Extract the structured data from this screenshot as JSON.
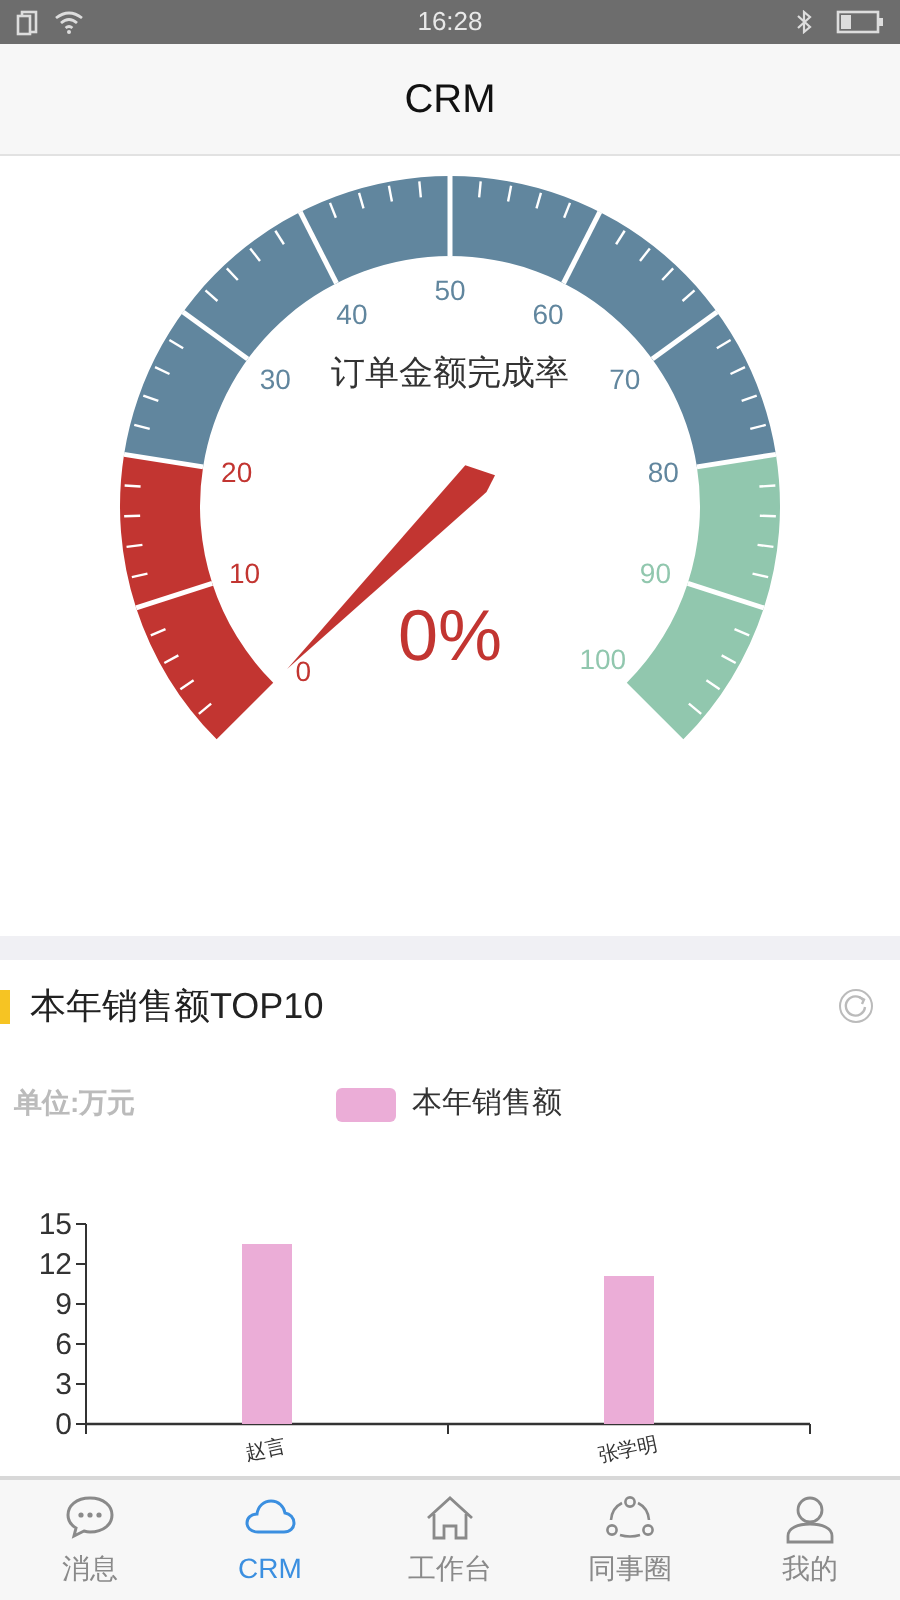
{
  "status_bar": {
    "time": "16:28"
  },
  "header": {
    "title": "CRM"
  },
  "gauge": {
    "title": "订单金额完成率",
    "value_text": "0%",
    "tick_labels": [
      "0",
      "10",
      "20",
      "30",
      "40",
      "50",
      "60",
      "70",
      "80",
      "90",
      "100"
    ],
    "bands": [
      {
        "color": "#c23531"
      },
      {
        "color": "#61869e"
      },
      {
        "color": "#91c7ae"
      }
    ]
  },
  "sales_section": {
    "title": "本年销售额TOP10",
    "chart_data": {
      "type": "bar",
      "ylabel": "单位:万元",
      "categories": [
        "赵言",
        "张学明"
      ],
      "series": [
        {
          "name": "本年销售额",
          "color": "#ebadd7",
          "values": [
            13.5,
            11.1
          ]
        }
      ],
      "ylim": [
        0,
        15
      ],
      "yticks": [
        0,
        3,
        6,
        9,
        12,
        15
      ]
    }
  },
  "tab_bar": [
    {
      "label": "消息",
      "selected": false
    },
    {
      "label": "CRM",
      "selected": true
    },
    {
      "label": "工作台",
      "selected": false
    },
    {
      "label": "同事圈",
      "selected": false
    },
    {
      "label": "我的",
      "selected": false
    }
  ]
}
